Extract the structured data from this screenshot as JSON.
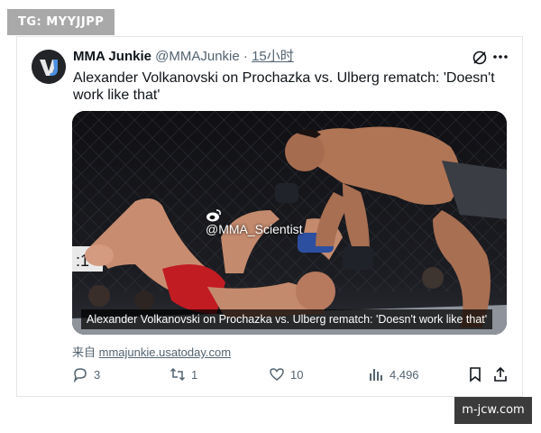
{
  "overlay": {
    "top_badge": "TG: MYYJJPP",
    "bottom_badge": "m-jcw.com"
  },
  "tweet": {
    "display_name": "MMA Junkie",
    "handle": "@MMAJunkie",
    "separator": "·",
    "time": "15小时",
    "text": "Alexander Volkanovski on Prochazka vs. Ulberg rematch: 'Doesn't work like that'",
    "media": {
      "watermark": "@MMA_Scientist",
      "caption": "Alexander Volkanovski on Prochazka vs. Ulberg rematch: 'Doesn't work like that'"
    },
    "source_prefix": "来自",
    "source_domain": "mmajunkie.usatoday.com",
    "stats": {
      "replies": "3",
      "retweets": "1",
      "likes": "10",
      "views": "4,496"
    }
  },
  "colors": {
    "muted": "#536471",
    "text": "#0f1419",
    "border": "#e6e6e6"
  },
  "icons": [
    "grok-icon",
    "more-icon",
    "reply-icon",
    "retweet-icon",
    "like-icon",
    "views-icon",
    "bookmark-icon",
    "share-icon",
    "weibo-icon"
  ]
}
